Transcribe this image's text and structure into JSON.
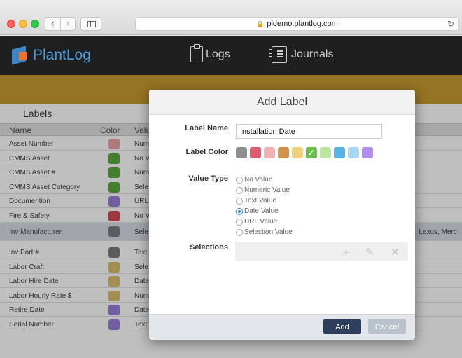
{
  "browser": {
    "url": "pldemo.plantlog.com",
    "icons": {
      "back": "chevron-left-icon",
      "forward": "chevron-right-icon",
      "sidebar": "sidebar-icon",
      "lock": "lock-icon",
      "reload": "reload-icon"
    }
  },
  "app": {
    "logo_text": "PlantLog",
    "nav": [
      {
        "label": "Logs",
        "icon": "clipboard-icon"
      },
      {
        "label": "Journals",
        "icon": "notebook-icon"
      }
    ],
    "band_color": "#c79b32"
  },
  "labels": {
    "title": "Labels",
    "columns": {
      "name": "Name",
      "color": "Color",
      "value": "Valu"
    },
    "rows": [
      {
        "name": "Asset Number",
        "color": "#e8a3a3",
        "value": "Num"
      },
      {
        "name": "CMMS Asset",
        "color": "#5aaa3c",
        "value": "No V"
      },
      {
        "name": "CMMS Asset #",
        "color": "#5aaa3c",
        "value": "Num"
      },
      {
        "name": "CMMS Asset Category",
        "color": "#5aaa3c",
        "value": "Sele"
      },
      {
        "name": "Documention",
        "color": "#9b7ed8",
        "value": "URL"
      },
      {
        "name": "Fire & Safety",
        "color": "#d44a56",
        "value": "No V"
      },
      {
        "name": "Inv Manufacturer",
        "color": "#7b7b7b",
        "value": "Sele",
        "extra": "r, Lexus, Merc"
      },
      {
        "name": "Inv Part #",
        "color": "#7b7b7b",
        "value": "Text"
      },
      {
        "name": "Labor Craft",
        "color": "#d9bf6a",
        "value": "Sele"
      },
      {
        "name": "Labor Hire Date",
        "color": "#d9bf6a",
        "value": "Date"
      },
      {
        "name": "Labor Hourly Rate $",
        "color": "#d9bf6a",
        "value": "Num"
      },
      {
        "name": "Retire Date",
        "color": "#9b7ed8",
        "value": "Date"
      },
      {
        "name": "Serial Number",
        "color": "#9b7ed8",
        "value": "Text"
      }
    ]
  },
  "modal": {
    "title": "Add Label",
    "label_name_label": "Label Name",
    "label_name_value": "Installation Date",
    "label_color_label": "Label Color",
    "colors": [
      "#8f8f8f",
      "#dc5d6e",
      "#f0b2b2",
      "#d4914c",
      "#f0d27c",
      "#6cc04a",
      "#bde6a0",
      "#5ab2e8",
      "#a8d8ef",
      "#b08ef0"
    ],
    "selected_color_index": 5,
    "value_type_label": "Value Type",
    "value_types": [
      "No Value",
      "Numeric Value",
      "Text Value",
      "Date Value",
      "URL Value",
      "Selection Value"
    ],
    "selected_value_type_index": 3,
    "selections_label": "Selections",
    "selection_icons": [
      "plus-icon",
      "pencil-icon",
      "close-icon"
    ],
    "add_label": "Add",
    "cancel_label": "Cancel"
  }
}
